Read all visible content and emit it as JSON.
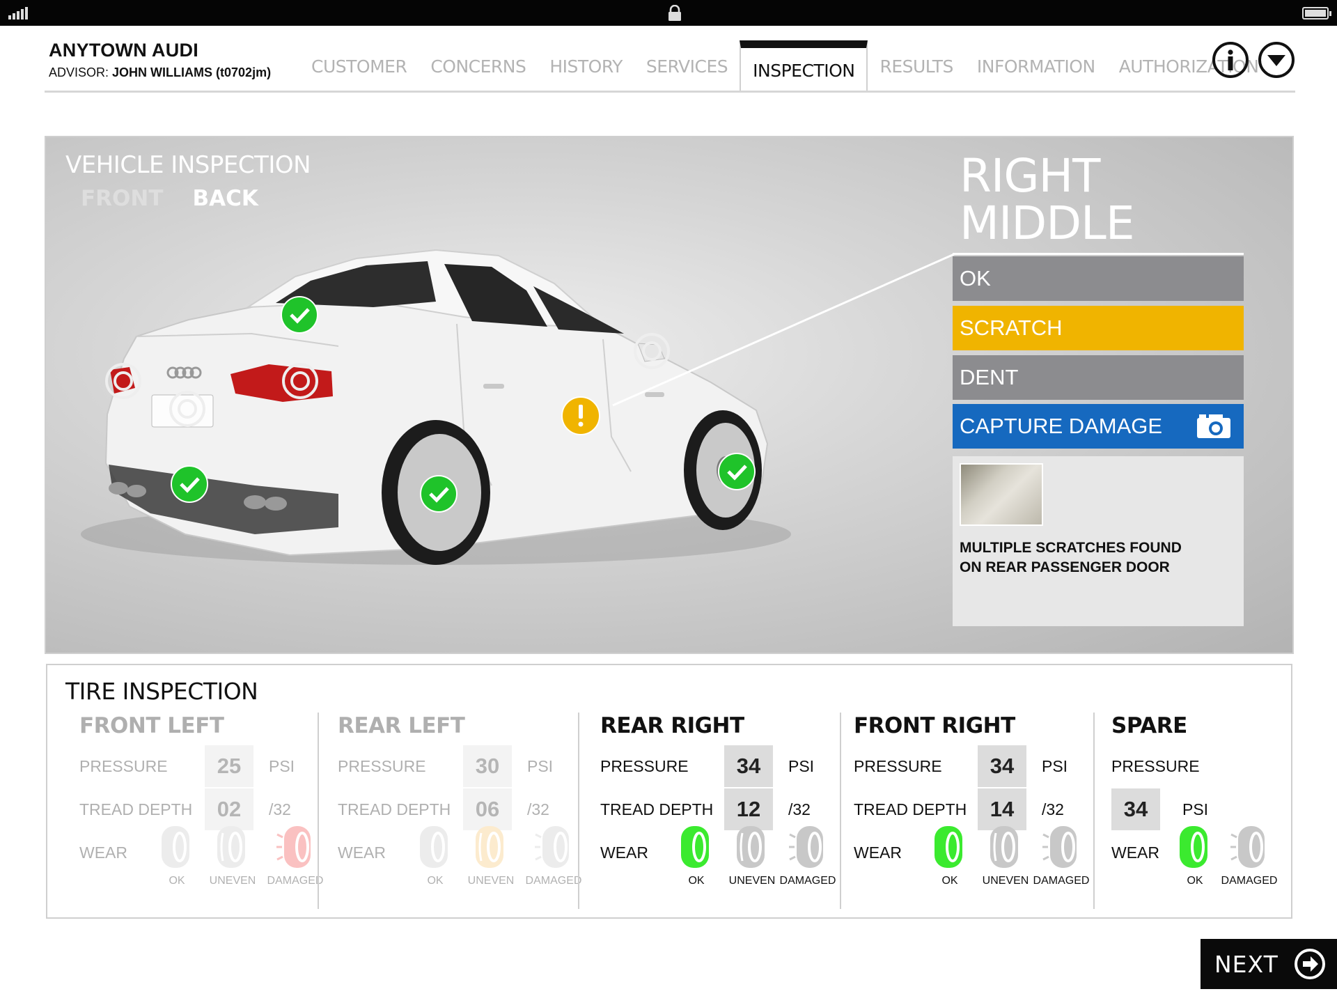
{
  "header": {
    "dealer": "ANYTOWN AUDI",
    "advisor_label": "ADVISOR:",
    "advisor_name": "JOHN WILLIAMS (t0702jm)",
    "tabs": [
      {
        "label": "CUSTOMER"
      },
      {
        "label": "CONCERNS"
      },
      {
        "label": "HISTORY"
      },
      {
        "label": "SERVICES"
      },
      {
        "label": "INSPECTION"
      },
      {
        "label": "RESULTS"
      },
      {
        "label": "INFORMATION"
      },
      {
        "label": "AUTHORIZATION"
      }
    ],
    "active_tab": "INSPECTION",
    "info_icon": "info-icon",
    "menu_icon": "chevron-down-circle-icon"
  },
  "vehicle": {
    "title": "VEHICLE INSPECTION",
    "view_front": "FRONT",
    "view_back": "BACK",
    "active_view": "BACK",
    "zone_line1": "RIGHT",
    "zone_line2": "MIDDLE",
    "options": {
      "ok": "OK",
      "scratch": "SCRATCH",
      "dent": "DENT",
      "capture": "CAPTURE DAMAGE"
    },
    "selected_option": "SCRATCH",
    "note_line1": "MULTIPLE SCRATCHES FOUND",
    "note_line2": "ON REAR PASSENGER DOOR",
    "marker_status": [
      "ok",
      "ok",
      "ok",
      "ok",
      "warning",
      "unchecked",
      "unchecked",
      "unchecked",
      "unchecked"
    ],
    "colors": {
      "ok": "#1fc32a",
      "warning": "#f0b400",
      "capture": "#1669bf"
    }
  },
  "tires": {
    "title": "TIRE INSPECTION",
    "pressure_label": "PRESSURE",
    "tread_label": "TREAD DEPTH",
    "wear_label": "WEAR",
    "psi_unit": "PSI",
    "tread_unit": "/32",
    "cap_ok": "OK",
    "cap_uneven": "UNEVEN",
    "cap_damaged": "DAMAGED",
    "front_left": {
      "name": "FRONT LEFT",
      "pressure": "25",
      "tread": "02",
      "wear": "damaged"
    },
    "rear_left": {
      "name": "REAR LEFT",
      "pressure": "30",
      "tread": "06",
      "wear": "uneven"
    },
    "rear_right": {
      "name": "REAR RIGHT",
      "pressure": "34",
      "tread": "12",
      "wear": "ok"
    },
    "front_right": {
      "name": "FRONT RIGHT",
      "pressure": "34",
      "tread": "14",
      "wear": "ok"
    },
    "spare": {
      "name": "SPARE",
      "pressure": "34",
      "wear": "ok"
    },
    "colors": {
      "ok": "#3bea2f",
      "uneven": "#f7c56e",
      "damaged": "#f04545",
      "neutral": "#c8c8c8"
    }
  },
  "footer": {
    "next_label": "NEXT",
    "next_icon": "arrow-right-circle-icon"
  }
}
